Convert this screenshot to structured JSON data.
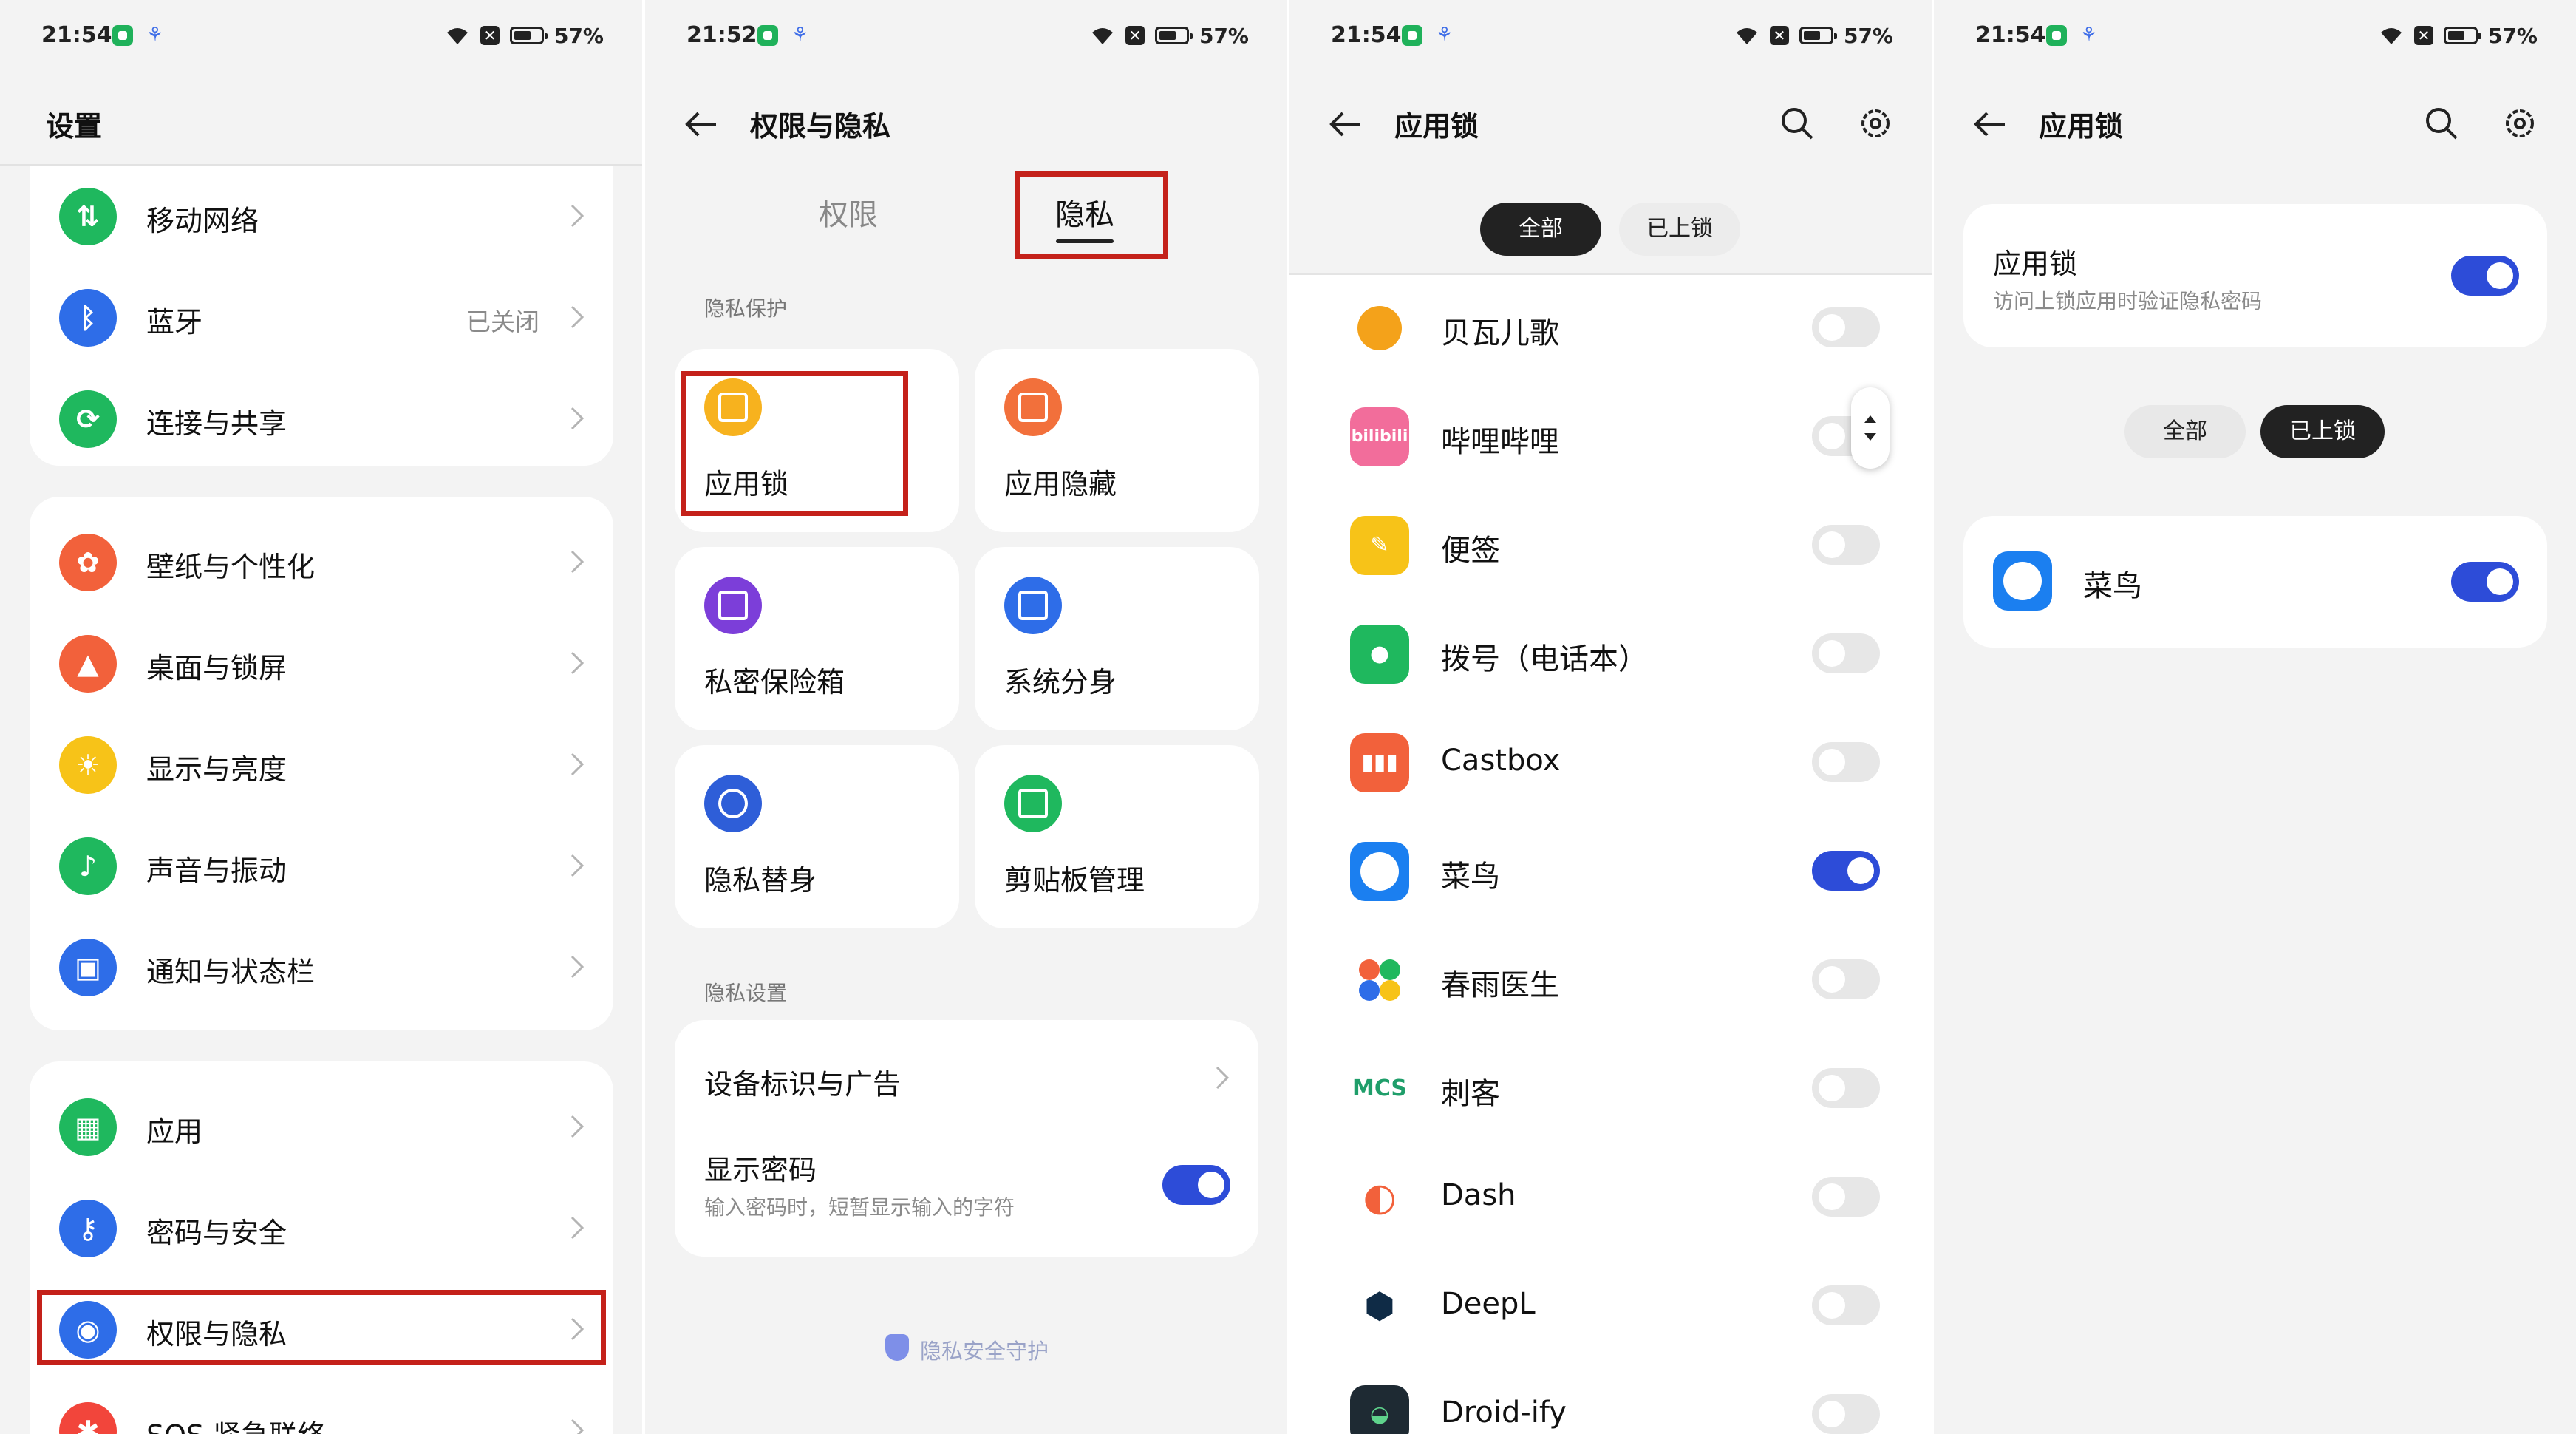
{
  "panels": [
    {
      "status": {
        "time": "21:54",
        "battery": "57%"
      },
      "title": "设置",
      "groups": [
        [
          {
            "label": "移动网络",
            "icon": "mobile-data-icon",
            "color": "#1fb85e"
          },
          {
            "label": "蓝牙",
            "value": "已关闭",
            "icon": "bluetooth-icon",
            "color": "#2e6de8"
          },
          {
            "label": "连接与共享",
            "icon": "share-icon",
            "color": "#1fb85e"
          }
        ],
        [
          {
            "label": "壁纸与个性化",
            "icon": "palette-icon",
            "color": "#f2613b"
          },
          {
            "label": "桌面与锁屏",
            "icon": "image-icon",
            "color": "#f2613b"
          },
          {
            "label": "显示与亮度",
            "icon": "brightness-icon",
            "color": "#f7c318"
          },
          {
            "label": "声音与振动",
            "icon": "bell-icon",
            "color": "#1fb85e"
          },
          {
            "label": "通知与状态栏",
            "icon": "notification-icon",
            "color": "#2e6de8"
          }
        ],
        [
          {
            "label": "应用",
            "icon": "apps-icon",
            "color": "#1fb85e"
          },
          {
            "label": "密码与安全",
            "icon": "key-icon",
            "color": "#2e6de8"
          },
          {
            "label": "权限与隐私",
            "icon": "privacy-icon",
            "color": "#2e6de8"
          },
          {
            "label": "SOS 紧急联络",
            "icon": "sos-icon",
            "color": "#f2453b"
          }
        ]
      ]
    },
    {
      "status": {
        "time": "21:52",
        "battery": "57%"
      },
      "title": "权限与隐私",
      "tabs": [
        "权限",
        "隐私"
      ],
      "section1": "隐私保护",
      "tiles": [
        {
          "label": "应用锁",
          "icon": "app-lock-icon",
          "color": "#f7b21e"
        },
        {
          "label": "应用隐藏",
          "icon": "app-hide-icon",
          "color": "#f2703b"
        },
        {
          "label": "私密保险箱",
          "icon": "safe-box-icon",
          "color": "#7c3ed9"
        },
        {
          "label": "系统分身",
          "icon": "clone-icon",
          "color": "#2e6de8"
        },
        {
          "label": "隐私替身",
          "icon": "eye-lock-icon",
          "color": "#2e5ed8"
        },
        {
          "label": "剪贴板管理",
          "icon": "clipboard-icon",
          "color": "#1fb85e"
        }
      ],
      "section2": "隐私设置",
      "settings": {
        "device_id": "设备标识与广告",
        "show_pw_title": "显示密码",
        "show_pw_desc": "输入密码时，短暂显示输入的字符"
      },
      "footer": "隐私安全守护"
    },
    {
      "status": {
        "time": "21:54",
        "battery": "57%"
      },
      "title": "应用锁",
      "segments": [
        "全部",
        "已上锁"
      ],
      "apps": [
        {
          "label": "贝瓦儿歌",
          "on": false,
          "color": "#ffffff"
        },
        {
          "label": "哔哩哔哩",
          "on": false,
          "color": "#f26d9b"
        },
        {
          "label": "便签",
          "on": false,
          "color": "#f7c318"
        },
        {
          "label": "拨号（电话本）",
          "on": false,
          "color": "#1fb85e"
        },
        {
          "label": "Castbox",
          "on": false,
          "color": "#f2613b"
        },
        {
          "label": "菜鸟",
          "on": true,
          "color": "#1b7ff0"
        },
        {
          "label": "春雨医生",
          "on": false,
          "color": "#ffffff"
        },
        {
          "label": "刺客",
          "on": false,
          "color": "#ffffff"
        },
        {
          "label": "Dash",
          "on": false,
          "color": "#ffffff"
        },
        {
          "label": "DeepL",
          "on": false,
          "color": "#ffffff"
        },
        {
          "label": "Droid-ify",
          "on": false,
          "color": "#1e2a33"
        }
      ]
    },
    {
      "status": {
        "time": "21:54",
        "battery": "57%"
      },
      "title": "应用锁",
      "lock_title": "应用锁",
      "lock_desc": "访问上锁应用时验证隐私密码",
      "segments": [
        "全部",
        "已上锁"
      ],
      "locked_app": "菜鸟"
    }
  ],
  "logos": {
    "bilibili": "bilibili",
    "mcs": "MCS"
  },
  "accent": "#2d4cd8",
  "annotation_color": "#c4211a"
}
